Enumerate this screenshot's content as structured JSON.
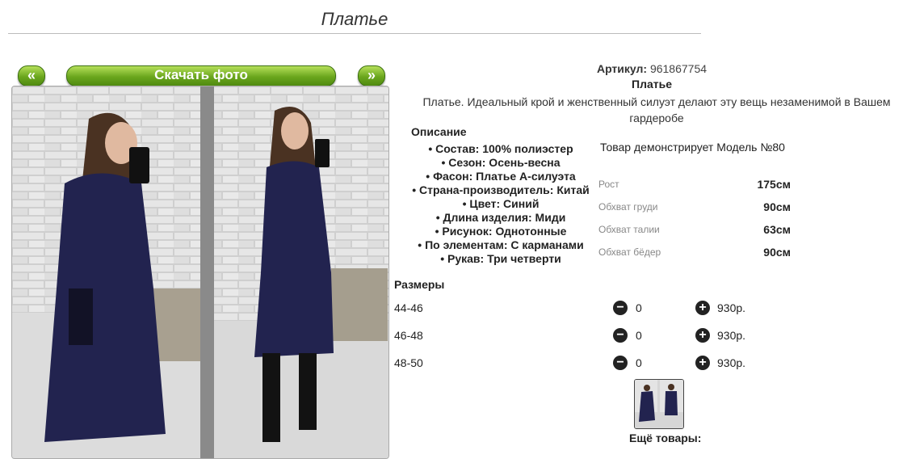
{
  "page": {
    "title": "Платье"
  },
  "gallery": {
    "prev_label": "«",
    "next_label": "»",
    "download_label": "Скачать фото"
  },
  "product": {
    "article_label": "Артикул:",
    "article_value": "961867754",
    "name": "Платье",
    "description": "Платье. Идеальный крой и женственный силуэт делают эту вещь незаменимой в Вашем гардеробе",
    "description_heading": "Описание",
    "properties": [
      "Состав: 100% полиэстер",
      "Сезон: Осень-весна",
      "Фасон: Платье А-силуэта",
      "Страна-производитель: Китай",
      "Цвет: Синий",
      "Длина изделия: Миди",
      "Рисунок: Однотонные",
      "По элементам: С карманами",
      "Рукав: Три четверти"
    ]
  },
  "model": {
    "note": "Товар демонстрирует Модель №80",
    "measurements": [
      {
        "label": "Рост",
        "value": "175см"
      },
      {
        "label": "Обхват груди",
        "value": "90см"
      },
      {
        "label": "Обхват талии",
        "value": "63см"
      },
      {
        "label": "Обхват бёдер",
        "value": "90см"
      }
    ]
  },
  "sizes": {
    "heading": "Размеры",
    "rows": [
      {
        "size": "44-46",
        "minus": "−",
        "qty": "0",
        "plus": "+",
        "price": "930р."
      },
      {
        "size": "46-48",
        "minus": "−",
        "qty": "0",
        "plus": "+",
        "price": "930р."
      },
      {
        "size": "48-50",
        "minus": "−",
        "qty": "0",
        "plus": "+",
        "price": "930р."
      }
    ]
  },
  "more_products_label": "Ещё товары:",
  "colors": {
    "accent_green": "#6aa61d",
    "dress_navy": "#22234f"
  }
}
